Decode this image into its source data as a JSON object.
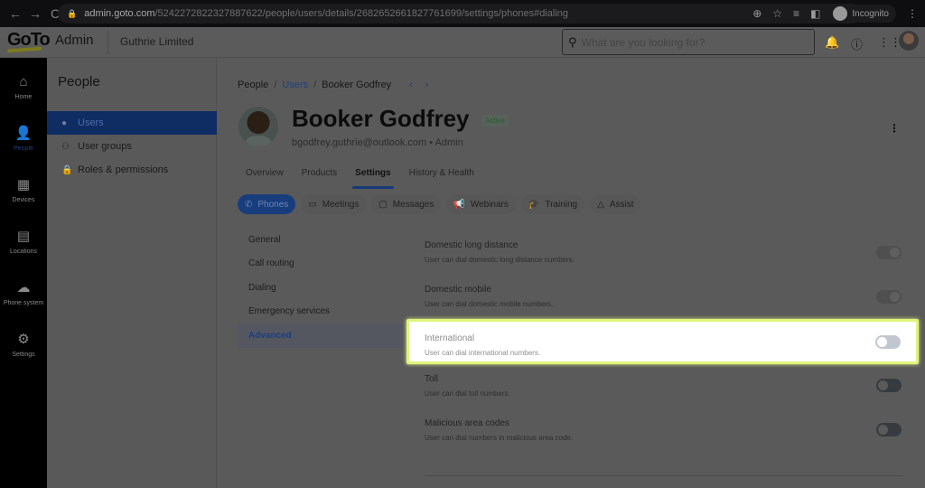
{
  "browser": {
    "back": "←",
    "forward": "→",
    "reload": "C",
    "url_host": "admin.goto.com",
    "url_path": "/5242272822327887622/people/users/details/2682652661827761699/settings/phones#dialing",
    "incognito_label": "Incognito"
  },
  "header": {
    "logo": "GoTo",
    "app_name": "Admin",
    "company": "Guthrie Limited",
    "search_placeholder": "What are you looking for?"
  },
  "rail": {
    "items": [
      {
        "label": "Home",
        "icon": "⌂"
      },
      {
        "label": "People",
        "icon": "👤"
      },
      {
        "label": "Devices",
        "icon": "▦"
      },
      {
        "label": "Locations",
        "icon": "▤"
      },
      {
        "label": "Phone system",
        "icon": "☁"
      },
      {
        "label": "Settings",
        "icon": "⚙"
      }
    ]
  },
  "subnav": {
    "title": "People",
    "items": [
      {
        "label": "Users",
        "icon": "●"
      },
      {
        "label": "User groups",
        "icon": "⚇"
      },
      {
        "label": "Roles & permissions",
        "icon": "🔒"
      }
    ]
  },
  "breadcrumb": {
    "root": "People",
    "link": "Users",
    "current": "Booker Godfrey",
    "sep": "/",
    "prev": "‹",
    "next": "›"
  },
  "user": {
    "name": "Booker Godfrey",
    "status": "Active",
    "subtitle": "bgodfrey.guthrie@outlook.com • Admin"
  },
  "tabs": [
    "Overview",
    "Products",
    "Settings",
    "History & Health"
  ],
  "pills": [
    {
      "label": "Phones",
      "icon": "✆"
    },
    {
      "label": "Meetings",
      "icon": "▭"
    },
    {
      "label": "Messages",
      "icon": "▢"
    },
    {
      "label": "Webinars",
      "icon": "📢"
    },
    {
      "label": "Training",
      "icon": "🎓"
    },
    {
      "label": "Assist",
      "icon": "△"
    }
  ],
  "settings_nav": [
    "General",
    "Call routing",
    "Dialing",
    "Emergency services",
    "Advanced"
  ],
  "dialing_settings": [
    {
      "title": "Domestic long distance",
      "desc": "User can dial domestic long distance numbers.",
      "enabled": true
    },
    {
      "title": "Domestic mobile",
      "desc": "User can dial domestic mobile numbers.",
      "enabled": true
    },
    {
      "title": "International",
      "desc": "User can dial international numbers.",
      "enabled": false
    },
    {
      "title": "Toll",
      "desc": "User can dial toll numbers.",
      "enabled": false
    },
    {
      "title": "Malicious area codes",
      "desc": "User can dial numbers in malicious area code.",
      "enabled": false
    }
  ],
  "colors": {
    "brand_blue": "#0f2c63",
    "highlight_border": "#dff57a",
    "logo_accent": "#7d7a1c"
  }
}
